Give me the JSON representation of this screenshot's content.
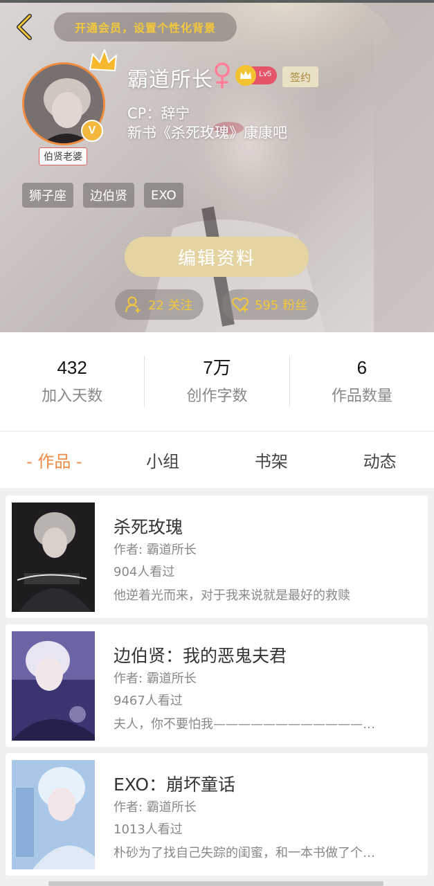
{
  "header": {
    "vip_prompt": "开通会员，设置个性化背景"
  },
  "profile": {
    "avatar_caption": "伯贤老婆",
    "verified_badge": "V",
    "name": "霸道所长",
    "level": "Lv5",
    "signed_label": "签约",
    "bio_line_1": "CP：辞宁",
    "bio_line_2": "新书《杀死玫瑰》康康吧",
    "tags": [
      "狮子座",
      "边伯贤",
      "EXO"
    ],
    "edit_button": "编辑资料",
    "following": "22 关注",
    "fans": "595 粉丝"
  },
  "stats": [
    {
      "value": "432",
      "label": "加入天数"
    },
    {
      "value": "7万",
      "label": "创作字数"
    },
    {
      "value": "6",
      "label": "作品数量"
    }
  ],
  "tabs": [
    {
      "label": "- 作品 -",
      "active": true
    },
    {
      "label": "小组",
      "active": false
    },
    {
      "label": "书架",
      "active": false
    },
    {
      "label": "动态",
      "active": false
    }
  ],
  "works": [
    {
      "title": "杀死玫瑰",
      "author": "作者: 霸道所长",
      "views": "904人看过",
      "desc": "他逆着光而来，对于我来说就是最好的救赎"
    },
    {
      "title": "边伯贤：我的恶鬼夫君",
      "author": "作者: 霸道所长",
      "views": "9467人看过",
      "desc": "夫人，你不要怕我————————————…"
    },
    {
      "title": "EXO：崩坏童话",
      "author": "作者: 霸道所长",
      "views": "1013人看过",
      "desc": "朴砂为了找自己失踪的闺蜜，和一本书做了个…"
    }
  ],
  "colors": {
    "accent": "#ee8a44",
    "gold": "#f3c83a",
    "edit_button": "#e4d4a4"
  }
}
